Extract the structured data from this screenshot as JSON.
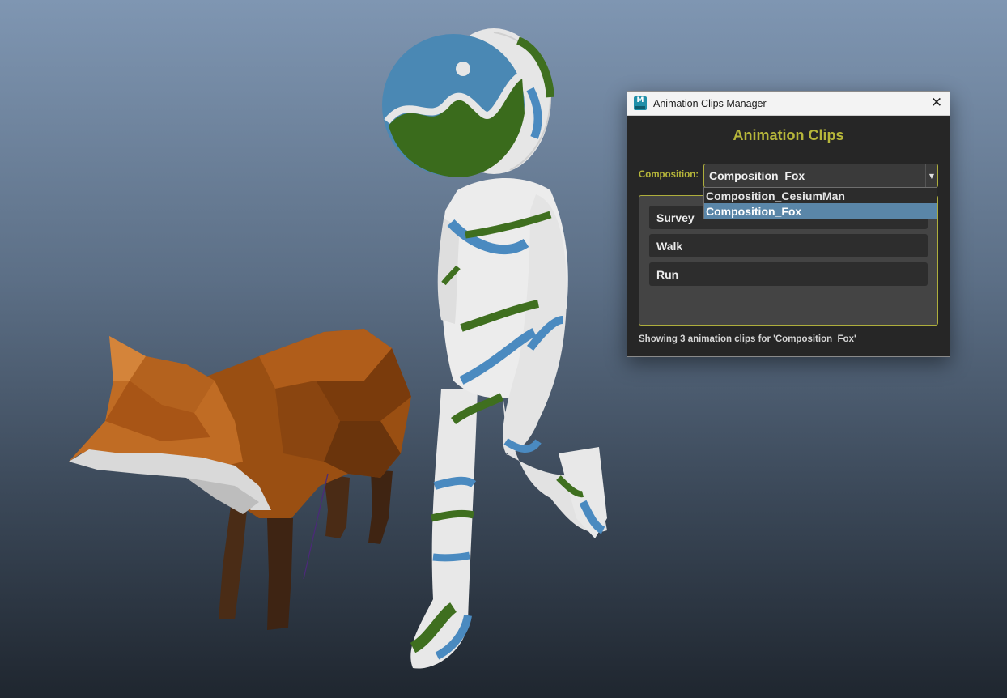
{
  "window": {
    "title": "Animation Clips Manager",
    "app_icon_letter": "M",
    "close_glyph": "✕"
  },
  "panel": {
    "heading": "Animation Clips",
    "composition_label": "Composition:",
    "composition_value": "Composition_Fox",
    "dropdown_options": [
      "Composition_CesiumMan",
      "Composition_Fox"
    ],
    "dropdown_selected": "Composition_Fox",
    "clips": [
      "Survey",
      "Walk",
      "Run"
    ],
    "status": "Showing 3 animation clips for 'Composition_Fox'"
  },
  "colors": {
    "accent": "#b6b63a",
    "selection": "#5a86a8",
    "panel_bg": "#262626"
  },
  "viewport": {
    "subjects": [
      "fox-model",
      "cesium-man-model"
    ],
    "logo_colors": [
      "#4a88b4",
      "#3a6b1c",
      "#e6e6e6"
    ]
  }
}
